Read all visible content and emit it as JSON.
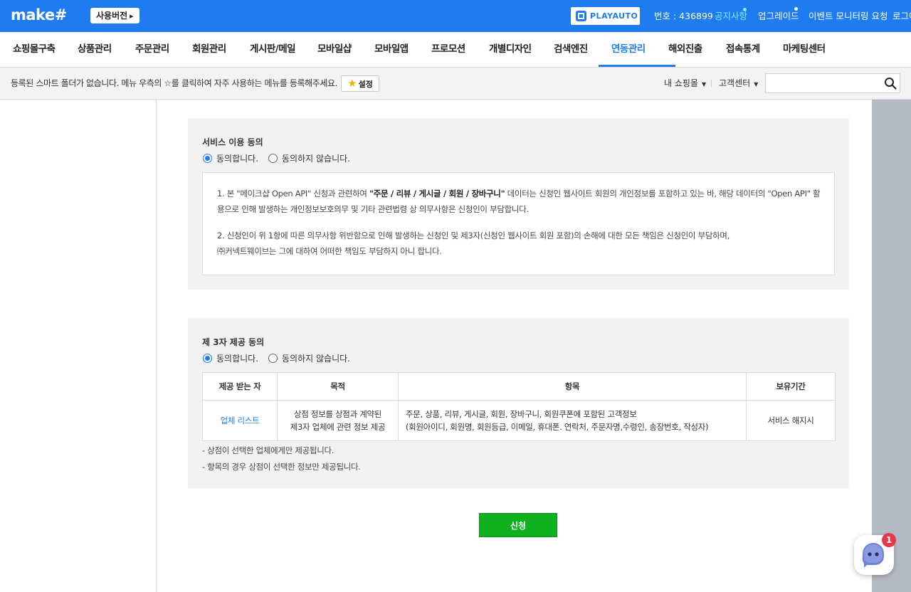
{
  "topbar": {
    "logo": "make#",
    "trial_label": "사용버전",
    "playauto_label": "PLAYAUTO",
    "account_number": "번호 : 436899",
    "notice": "공지사항",
    "upgrade": "업그레이드",
    "event_monitoring": "이벤트 모니터링 요청",
    "login": "로그아"
  },
  "mainnav": {
    "items": [
      {
        "label": "쇼핑몰구축"
      },
      {
        "label": "상품관리"
      },
      {
        "label": "주문관리"
      },
      {
        "label": "회원관리"
      },
      {
        "label": "게시판/메일"
      },
      {
        "label": "모바일샵"
      },
      {
        "label": "모바일앱"
      },
      {
        "label": "프로모션"
      },
      {
        "label": "개별디자인"
      },
      {
        "label": "검색엔진"
      },
      {
        "label": "연동관리"
      },
      {
        "label": "해외진출"
      },
      {
        "label": "접속통계"
      },
      {
        "label": "마케팅센터"
      }
    ],
    "active": "연동관리"
  },
  "subbar": {
    "message": "등록된 스마트 폴더가 없습니다. 메뉴 우측의 ☆를 클릭하여 자주 사용하는 메뉴를 등록해주세요.",
    "setting_label": "설정",
    "my_shop": "내 쇼핑몰",
    "customer_center": "고객센터",
    "search_placeholder": ""
  },
  "service_consent": {
    "title": "서비스 이용 동의",
    "agree": "동의합니다.",
    "disagree": "동의하지 않습니다.",
    "selected": "agree",
    "terms": [
      {
        "pre": "1. 본 \"메이크샵 Open API\" 신청과 관련하여 ",
        "bold": "\"주문 / 리뷰 / 게시글 / 회원 / 장바구니\"",
        "post": " 데이터는 신청인 웹사이트 회원의 개인정보를 포함하고 있는 바, 해당 데이터의 \"Open API\" 활용으로 인해 발생하는 개인정보보호의무 및 기타 관련법령 상 의무사항은 신청인이 부담합니다."
      },
      {
        "line1": "2. 신청인이 위 1항에 따른 의무사항 위반함으로 인해 발생하는 신청인 및 제3자(신청인 웹사이트 회원 포함)의 손해에 대한 모든 책임은 신청인이 부담하며,",
        "line2": "㈜커넥트웨이브는 그에 대하여 어떠한 책임도 부담하지 아니 합니다."
      }
    ]
  },
  "third_party_consent": {
    "title": "제 3자 제공 동의",
    "agree": "동의합니다.",
    "disagree": "동의하지 않습니다.",
    "selected": "agree",
    "table": {
      "headers": [
        "제공 받는 자",
        "목적",
        "항목",
        "보유기간"
      ],
      "row": {
        "recipient": "업체 리스트",
        "purpose_line1": "상점 정보를 상점과 계약된",
        "purpose_line2": "제3자 업체에 관련 정보 제공",
        "items_line1": "주문, 상품, 리뷰, 게시글, 회원, 장바구니, 회원쿠폰에 포함된 고객정보",
        "items_line2": "(회원아이디, 회원명, 회원등급, 이메일, 휴대폰. 연락처, 주문자명,수령인, 송장번호, 작성자)",
        "retention": "서비스 해지시"
      }
    },
    "notes": [
      "- 상점이 선택한 업체에게만 제공됩니다.",
      "- 항목의 경우 상점이 선택한 정보만 제공됩니다."
    ]
  },
  "apply_label": "신청",
  "chat": {
    "badge": "1"
  },
  "colors": {
    "brand": "#1f7cf0",
    "apply": "#0fb21e",
    "badge": "#e8374a"
  }
}
